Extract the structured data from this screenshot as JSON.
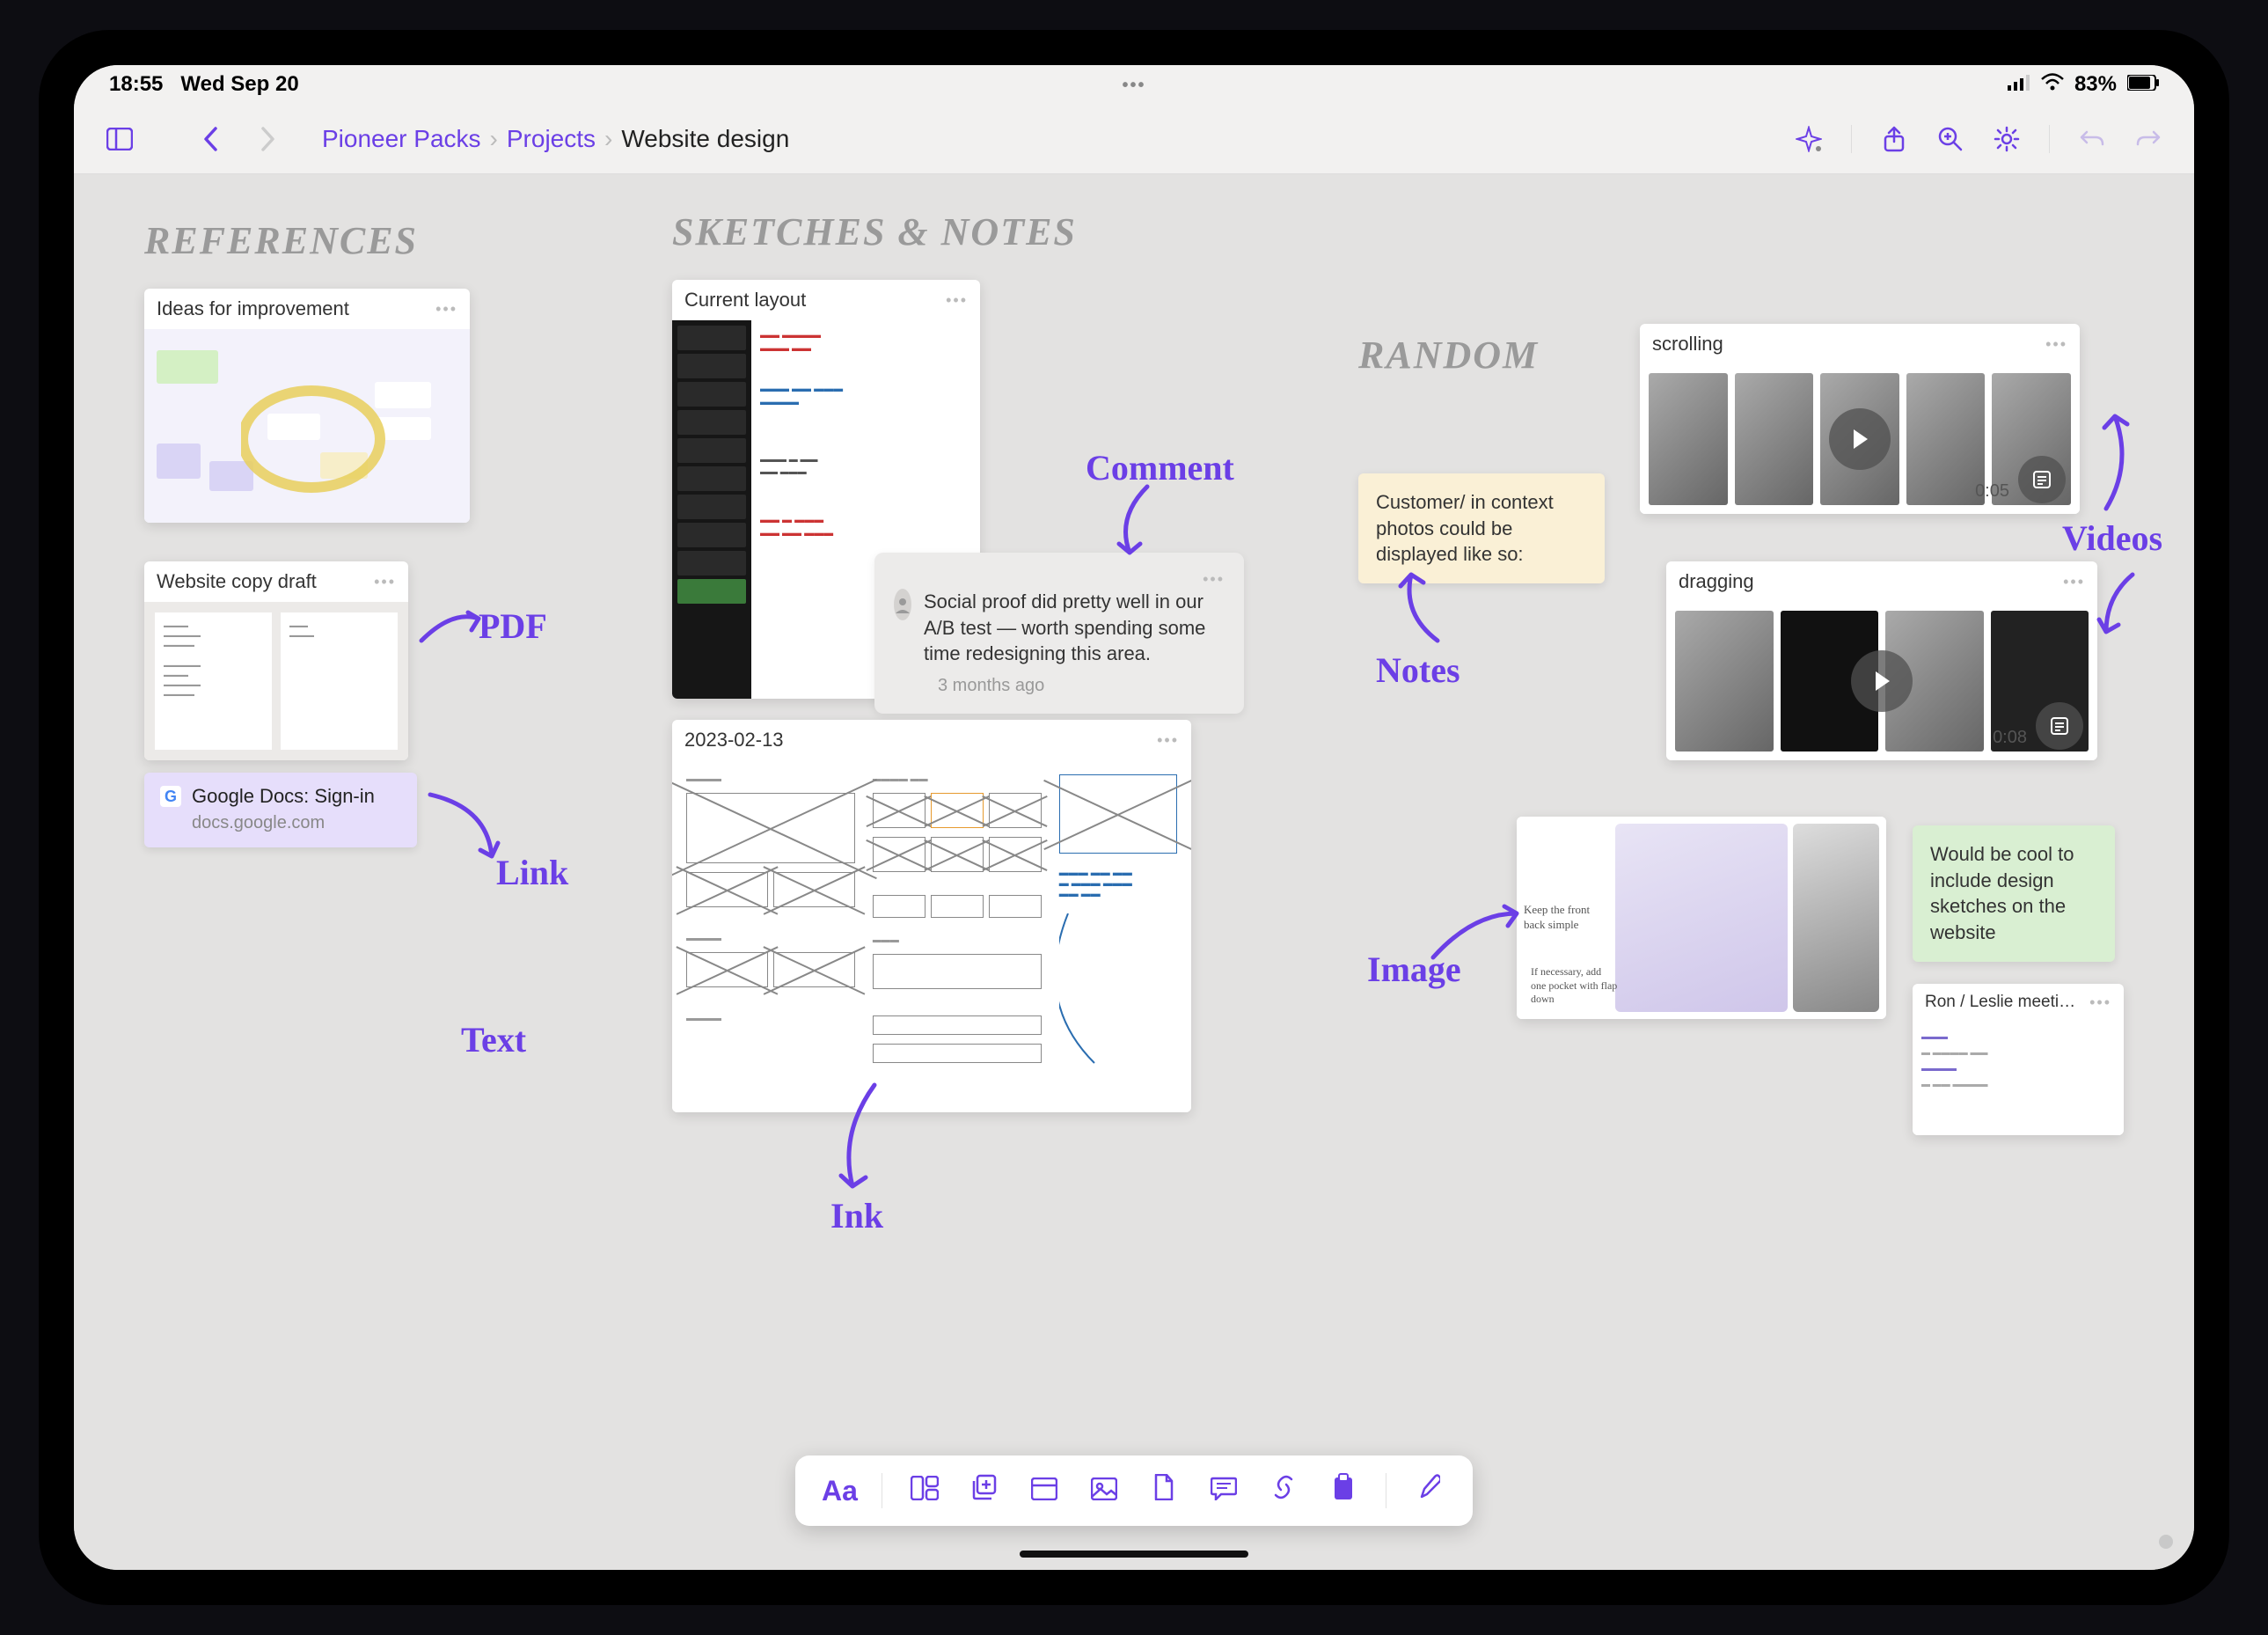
{
  "status": {
    "time": "18:55",
    "date": "Wed Sep 20",
    "battery": "83%"
  },
  "breadcrumb": {
    "root": "Pioneer Packs",
    "mid": "Projects",
    "current": "Website design"
  },
  "sections": {
    "references": "References",
    "sketches": "Sketches & Notes",
    "random": "Random"
  },
  "annotations": {
    "pdf": "PDF",
    "link": "Link",
    "text": "Text",
    "comment": "Comment",
    "ink": "Ink",
    "notes": "Notes",
    "image": "Image",
    "videos": "Videos"
  },
  "cards": {
    "ideas": {
      "title": "Ideas for improvement"
    },
    "copy": {
      "title": "Website copy draft"
    },
    "gdocs": {
      "title": "Google Docs: Sign-in",
      "sub": "docs.google.com"
    },
    "layout": {
      "title": "Current layout"
    },
    "wire": {
      "title": "2023-02-13"
    },
    "scroll": {
      "title": "scrolling",
      "duration": "0:05"
    },
    "drag": {
      "title": "dragging",
      "duration": "0:08"
    },
    "ron": {
      "title": "Ron / Leslie meeti…"
    }
  },
  "comment": {
    "text": "Social proof did pretty well in our A/B test — worth spending some time redesigning this area.",
    "time": "3 months ago"
  },
  "notes": {
    "yellow": "Customer/ in context photos could be displayed like so:",
    "green": "Would be cool to include design sketches on the website"
  },
  "bottombar": {
    "text_tool": "Aa"
  }
}
